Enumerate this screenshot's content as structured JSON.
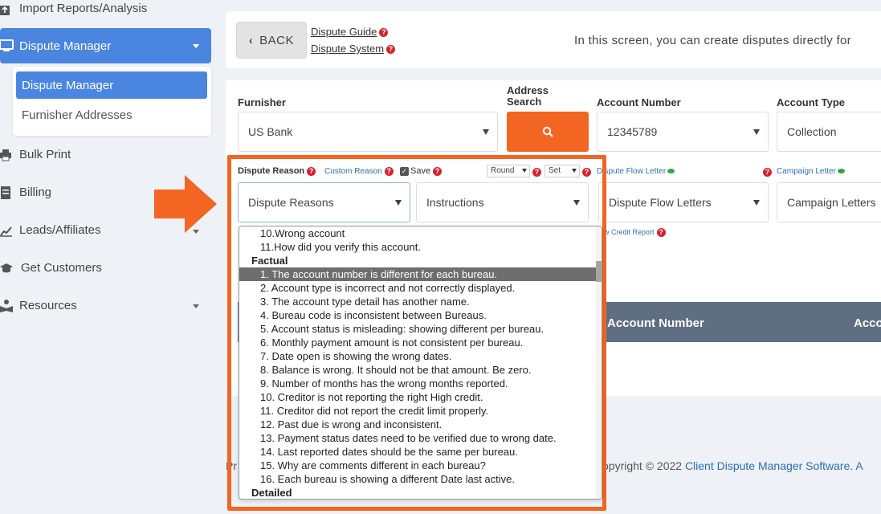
{
  "sidebar": {
    "import_reports": "Import Reports/Analysis",
    "dispute_manager": "Dispute Manager",
    "submenu": {
      "dispute_manager": "Dispute Manager",
      "furnisher_addresses": "Furnisher Addresses"
    },
    "bulk_print": "Bulk Print",
    "billing": "Billing",
    "leads_affiliates": "Leads/Affiliates",
    "get_customers": "Get Customers",
    "resources": "Resources"
  },
  "top": {
    "back_label": "BACK",
    "dispute_guide": "Dispute Guide",
    "dispute_system": "Dispute System",
    "intro_text": "In this screen, you can create disputes directly for"
  },
  "form": {
    "furnisher_label": "Furnisher",
    "furnisher_value": "US Bank",
    "address_search_label_1": "Address",
    "address_search_label_2": "Search",
    "account_number_label": "Account Number",
    "account_number_value": "12345789",
    "account_type_label": "Account Type",
    "account_type_value": "Collection",
    "dispute_reason_label": "Dispute Reason",
    "custom_reason_label": "Custom Reason",
    "save_label": "Save",
    "round_value": "Round",
    "set_value": "Set",
    "dispute_flow_letter_label": "Dispute Flow Letter",
    "campaign_letter_label": "Campaign Letter",
    "dispute_reasons_value": "Dispute Reasons",
    "instructions_value": "Instructions",
    "dispute_flow_letters_value": "Dispute Flow Letters",
    "campaign_letters_value": "Campaign Letters",
    "view_credit_report": "ew Credit Report"
  },
  "table": {
    "account_number_header": "Account Number",
    "account_type_header": "Acco"
  },
  "footer": {
    "left_fragment": "Pr",
    "copyright": "opyright © 2022 ",
    "brand": "Client Dispute Manager Software. A"
  },
  "dropdown": {
    "items": [
      {
        "text": "10.Wrong account",
        "kind": "item"
      },
      {
        "text": "11.How did you verify this account.",
        "kind": "item"
      },
      {
        "text": "Factual",
        "kind": "group"
      },
      {
        "text": "1. The account number is different for each bureau.",
        "kind": "selected"
      },
      {
        "text": "2. Account type is incorrect and not correctly displayed.",
        "kind": "item"
      },
      {
        "text": "3. The account type detail has another name.",
        "kind": "item"
      },
      {
        "text": "4. Bureau code is inconsistent between Bureaus.",
        "kind": "item"
      },
      {
        "text": "5. Account status is misleading: showing different per bureau.",
        "kind": "item"
      },
      {
        "text": "6. Monthly payment amount is not consistent per bureau.",
        "kind": "item"
      },
      {
        "text": "7. Date open is showing the wrong dates.",
        "kind": "item"
      },
      {
        "text": "8. Balance is wrong. It should not be that amount. Be zero.",
        "kind": "item"
      },
      {
        "text": "9. Number of months has the wrong months reported.",
        "kind": "item"
      },
      {
        "text": "10. Creditor is not reporting the right High credit.",
        "kind": "item"
      },
      {
        "text": "11. Creditor did not report the credit limit properly.",
        "kind": "item"
      },
      {
        "text": "12. Past due is wrong and inconsistent.",
        "kind": "item"
      },
      {
        "text": "13. Payment status dates need to be verified due to wrong date.",
        "kind": "item"
      },
      {
        "text": "14. Last reported dates should be the same per bureau.",
        "kind": "item"
      },
      {
        "text": "15. Why are comments different in each bureau?",
        "kind": "item"
      },
      {
        "text": "16. Each bureau is showing a different Date last active.",
        "kind": "item"
      },
      {
        "text": "Detailed",
        "kind": "group"
      }
    ]
  },
  "colors": {
    "accent_blue": "#4a86e0",
    "orange": "#f26522",
    "table_header": "#5f6e80",
    "help_red": "#d9202a"
  }
}
